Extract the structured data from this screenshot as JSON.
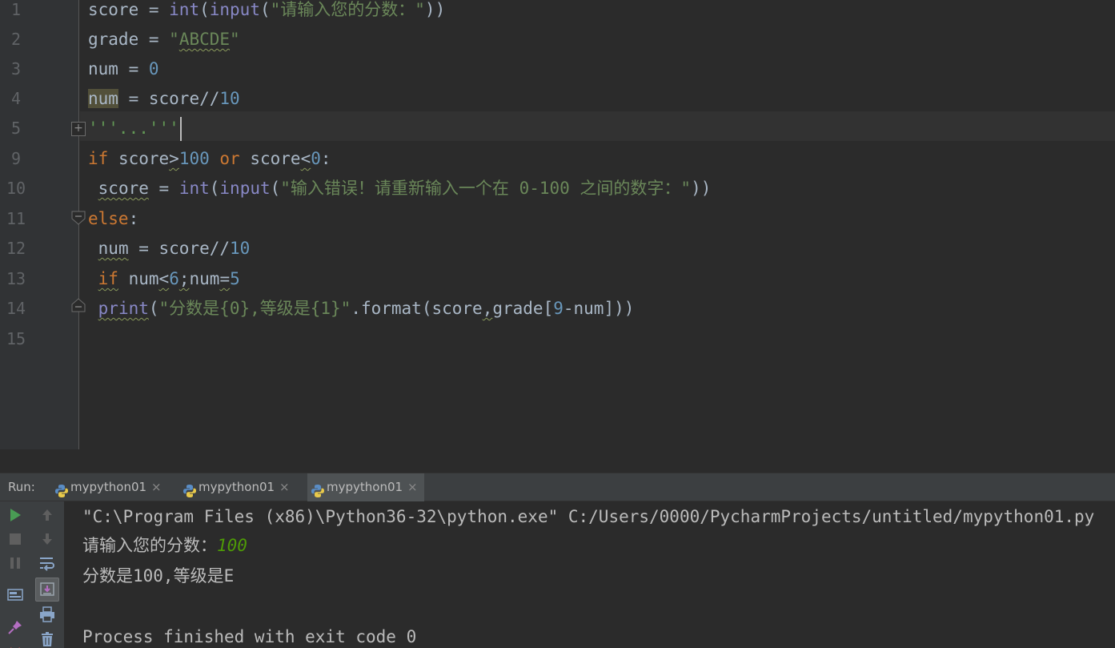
{
  "editor": {
    "line_numbers": [
      "1",
      "2",
      "3",
      "4",
      "5",
      "9",
      "10",
      "11",
      "12",
      "13",
      "14",
      "15"
    ],
    "code": {
      "l1": {
        "a": "score = ",
        "int": "int",
        "b": "(",
        "input": "input",
        "c": "(",
        "str": "\"请输入您的分数：\"",
        "d": "))"
      },
      "l2": {
        "a": "grade = ",
        "str_q1": "\"",
        "str_val": "ABCDE",
        "str_q2": "\""
      },
      "l3": {
        "a": "num = ",
        "n": "0"
      },
      "l4": {
        "hl": "num",
        "a": " = score//",
        "n": "10"
      },
      "l5": {
        "doc": "'''...'''"
      },
      "l9": {
        "kw_if": "if",
        "a": " score",
        "gt": ">",
        "n1": "100",
        "sp": " ",
        "kw_or": "or",
        "b": " score",
        "lt": "<",
        "n2": "0",
        "c": ":"
      },
      "l10": {
        "pre": " ",
        "score": "score",
        "a": " = ",
        "int": "int",
        "b": "(",
        "input": "input",
        "c": "(",
        "str": "\"输入错误！请重新输入一个在 0-100 之间的数字：\"",
        "d": "))"
      },
      "l11": {
        "kw_else": "else",
        "a": ":"
      },
      "l12": {
        "pre": " ",
        "num": "num",
        "a": " = score//",
        "n": "10"
      },
      "l13": {
        "pre": " ",
        "kw_if": "if",
        "a": " num",
        "lt": "<",
        "n": "6",
        "semi": ";",
        "b": "num",
        "eq": "=",
        "n2": "5"
      },
      "l14": {
        "pre": " ",
        "print": "print",
        "a": "(",
        "str": "\"分数是{0},等级是{1}\"",
        "b": ".format(score",
        "comma": ",",
        "c": "grade[",
        "n": "9",
        "d": "-num]))"
      }
    }
  },
  "run_panel": {
    "label": "Run:",
    "tabs": [
      {
        "label": "mypython01",
        "close": "×"
      },
      {
        "label": "mypython01",
        "close": "×"
      },
      {
        "label": "mypython01",
        "close": "×"
      }
    ],
    "console": {
      "line1": "\"C:\\Program Files (x86)\\Python36-32\\python.exe\" C:/Users/0000/PycharmProjects/untitled/mypython01.py",
      "line2_prompt": "请输入您的分数：",
      "line2_input": "100",
      "line3": "分数是100,等级是E",
      "line5": "Process finished with exit code 0"
    }
  },
  "colors": {
    "background": "#2b2b2b",
    "keyword": "#cc7832",
    "builtin": "#8888c6",
    "string": "#6a8759",
    "number": "#6897bb",
    "run_green": "#499c54",
    "user_input": "#4e9a06"
  },
  "icons": [
    "python-file-icon",
    "run-icon",
    "stop-icon",
    "pause-icon",
    "up-arrow-icon",
    "down-arrow-icon",
    "soft-wrap-icon",
    "scroll-to-end-icon",
    "print-icon",
    "trash-icon",
    "layout-icon",
    "pin-icon"
  ]
}
